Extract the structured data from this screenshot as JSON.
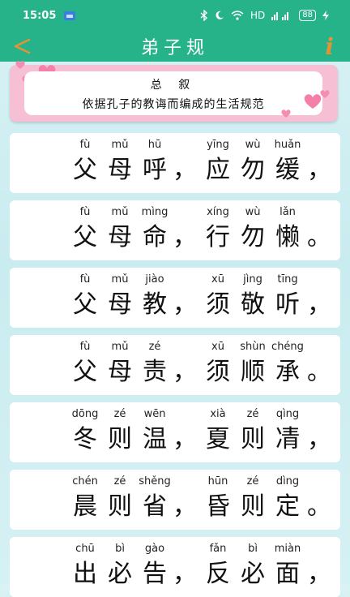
{
  "status": {
    "time": "15:05",
    "network": "HD",
    "battery": "88"
  },
  "header": {
    "back_label": "<",
    "title": "弟子规",
    "info_label": "i"
  },
  "intro": {
    "title": "总 叙",
    "subtitle": "依据孔子的教诲而编成的生活规范"
  },
  "colors": {
    "accent": "#26b38a",
    "frame": "#f6bfd4",
    "info": "#e0943a",
    "heart": "#f47fa8"
  },
  "verses": [
    {
      "pinyin": [
        "fù",
        "mǔ",
        "hū",
        "yīng",
        "wù",
        "huǎn"
      ],
      "hanzi": [
        "父",
        "母",
        "呼",
        "应",
        "勿",
        "缓"
      ],
      "punct": [
        "，",
        "，"
      ]
    },
    {
      "pinyin": [
        "fù",
        "mǔ",
        "mìng",
        "xíng",
        "wù",
        "lǎn"
      ],
      "hanzi": [
        "父",
        "母",
        "命",
        "行",
        "勿",
        "懒"
      ],
      "punct": [
        "，",
        "。"
      ]
    },
    {
      "pinyin": [
        "fù",
        "mǔ",
        "jiào",
        "xū",
        "jìng",
        "tīng"
      ],
      "hanzi": [
        "父",
        "母",
        "教",
        "须",
        "敬",
        "听"
      ],
      "punct": [
        "，",
        "，"
      ]
    },
    {
      "pinyin": [
        "fù",
        "mǔ",
        "zé",
        "xū",
        "shùn",
        "chéng"
      ],
      "hanzi": [
        "父",
        "母",
        "责",
        "须",
        "顺",
        "承"
      ],
      "punct": [
        "，",
        "。"
      ]
    },
    {
      "pinyin": [
        "dōng",
        "zé",
        "wēn",
        "xià",
        "zé",
        "qìng"
      ],
      "hanzi": [
        "冬",
        "则",
        "温",
        "夏",
        "则",
        "凊"
      ],
      "punct": [
        "，",
        "，"
      ]
    },
    {
      "pinyin": [
        "chén",
        "zé",
        "shěng",
        "hūn",
        "zé",
        "dìng"
      ],
      "hanzi": [
        "晨",
        "则",
        "省",
        "昏",
        "则",
        "定"
      ],
      "punct": [
        "，",
        "。"
      ]
    },
    {
      "pinyin": [
        "chū",
        "bì",
        "gào",
        "fǎn",
        "bì",
        "miàn"
      ],
      "hanzi": [
        "出",
        "必",
        "告",
        "反",
        "必",
        "面"
      ],
      "punct": [
        "，",
        "，"
      ]
    }
  ]
}
